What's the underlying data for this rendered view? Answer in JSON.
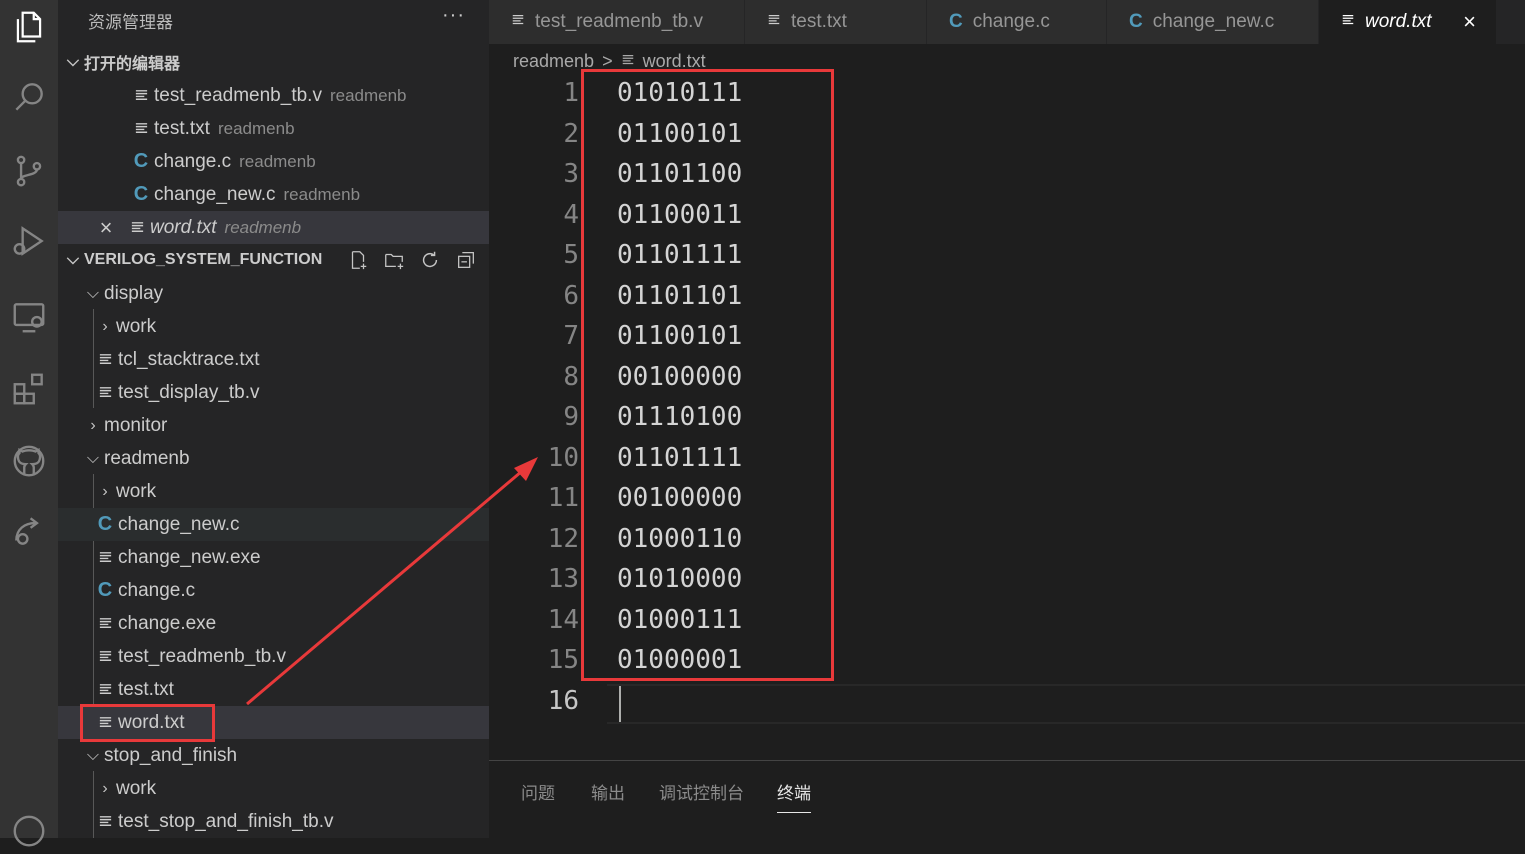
{
  "explorer": {
    "title": "资源管理器",
    "more": "···",
    "open_editors_header": "打开的编辑器",
    "open_editors": [
      {
        "icon": "text-file-icon",
        "name": "test_readmenb_tb.v",
        "desc": "readmenb"
      },
      {
        "icon": "text-file-icon",
        "name": "test.txt",
        "desc": "readmenb"
      },
      {
        "icon": "c-file-icon",
        "name": "change.c",
        "desc": "readmenb"
      },
      {
        "icon": "c-file-icon",
        "name": "change_new.c",
        "desc": "readmenb"
      },
      {
        "icon": "text-file-icon",
        "name": "word.txt",
        "desc": "readmenb",
        "close": "×"
      }
    ],
    "workspace_header": "VERILOG_SYSTEM_FUNCTION",
    "tree": [
      {
        "label": "display",
        "type": "folder-open"
      },
      {
        "label": "work",
        "type": "folder-closed"
      },
      {
        "label": "tcl_stacktrace.txt",
        "type": "text"
      },
      {
        "label": "test_display_tb.v",
        "type": "text"
      },
      {
        "label": "monitor",
        "type": "folder-closed"
      },
      {
        "label": "readmenb",
        "type": "folder-open"
      },
      {
        "label": "work",
        "type": "folder-closed"
      },
      {
        "label": "change_new.c",
        "type": "c"
      },
      {
        "label": "change_new.exe",
        "type": "text"
      },
      {
        "label": "change.c",
        "type": "c"
      },
      {
        "label": "change.exe",
        "type": "text"
      },
      {
        "label": "test_readmenb_tb.v",
        "type": "text"
      },
      {
        "label": "test.txt",
        "type": "text"
      },
      {
        "label": "word.txt",
        "type": "text"
      },
      {
        "label": "stop_and_finish",
        "type": "folder-open"
      },
      {
        "label": "work",
        "type": "folder-closed"
      },
      {
        "label": "test_stop_and_finish_tb.v",
        "type": "text"
      }
    ]
  },
  "tabs": [
    {
      "label": "test_readmenb_tb.v",
      "icon": "text-file-icon"
    },
    {
      "label": "test.txt",
      "icon": "text-file-icon"
    },
    {
      "label": "change.c",
      "icon": "c-file-icon"
    },
    {
      "label": "change_new.c",
      "icon": "c-file-icon"
    },
    {
      "label": "word.txt",
      "icon": "text-file-icon",
      "active": true,
      "close": "×"
    }
  ],
  "breadcrumb": {
    "folder": "readmenb",
    "separator": ">",
    "file": "word.txt"
  },
  "editor": {
    "lines": [
      "01010111",
      "01100101",
      "01101100",
      "01100011",
      "01101111",
      "01101101",
      "01100101",
      "00100000",
      "01110100",
      "01101111",
      "00100000",
      "01000110",
      "01010000",
      "01000111",
      "01000001",
      ""
    ],
    "line_numbers": [
      "1",
      "2",
      "3",
      "4",
      "5",
      "6",
      "7",
      "8",
      "9",
      "10",
      "11",
      "12",
      "13",
      "14",
      "15",
      "16"
    ]
  },
  "panel_tabs": [
    "问题",
    "输出",
    "调试控制台",
    "终端"
  ],
  "colors": {
    "annotation": "#e8393a",
    "c_icon": "#519aba",
    "selection": "#37373d"
  }
}
